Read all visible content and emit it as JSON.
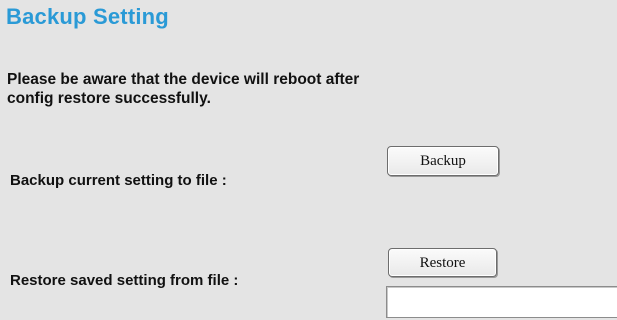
{
  "page": {
    "title": "Backup Setting",
    "warning_line1": "Please be aware that the device will reboot after",
    "warning_line2": "config restore successfully."
  },
  "backup": {
    "label": "Backup current setting to file :",
    "button_label": "Backup"
  },
  "restore": {
    "label": "Restore saved setting from file :",
    "button_label": "Restore",
    "file_value": ""
  },
  "colors": {
    "title": "#2a9ad6",
    "background": "#e4e4e4",
    "text": "#111111"
  }
}
